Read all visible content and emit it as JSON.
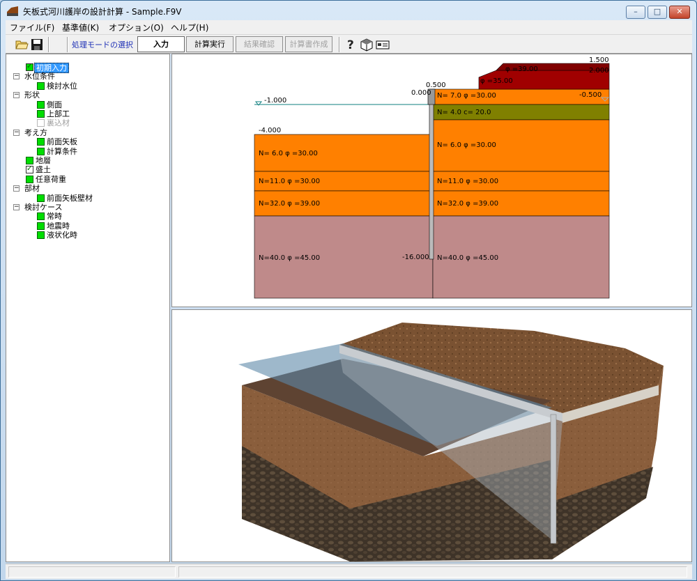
{
  "window": {
    "title": "矢板式河川護岸の設計計算 - Sample.F9V",
    "minimize": "–",
    "maximize": "□",
    "close": "✕"
  },
  "menu": [
    "ファイル(F)",
    "基準値(K)",
    "オプション(O)",
    "ヘルプ(H)"
  ],
  "toolbar": {
    "mode_label": "処理モードの選択",
    "modes": [
      {
        "label": "入力",
        "state": "active"
      },
      {
        "label": "計算実行",
        "state": "enabled"
      },
      {
        "label": "結果確認",
        "state": "disabled"
      },
      {
        "label": "計算書作成",
        "state": "disabled"
      }
    ],
    "icons": [
      "open-folder-icon",
      "save-icon",
      "help-icon",
      "3d-view-icon",
      "card-icon"
    ]
  },
  "tree": [
    {
      "label": "初期入力",
      "mark": "check-green",
      "level": 0,
      "selected": true
    },
    {
      "label": "水位条件",
      "mark": "none",
      "level": 1,
      "expander": "−"
    },
    {
      "label": "検討水位",
      "mark": "green",
      "level": 2
    },
    {
      "label": "形状",
      "mark": "none",
      "level": 1,
      "expander": "−"
    },
    {
      "label": "側面",
      "mark": "green",
      "level": 2
    },
    {
      "label": "上部工",
      "mark": "green",
      "level": 2
    },
    {
      "label": "裏込材",
      "mark": "gray",
      "level": 2,
      "disabled": true
    },
    {
      "label": "考え方",
      "mark": "none",
      "level": 1,
      "expander": "−"
    },
    {
      "label": "前面矢板",
      "mark": "green",
      "level": 2
    },
    {
      "label": "計算条件",
      "mark": "green",
      "level": 2
    },
    {
      "label": "地層",
      "mark": "green",
      "level": 0
    },
    {
      "label": "盛土",
      "mark": "check",
      "level": 0
    },
    {
      "label": "任意荷重",
      "mark": "green",
      "level": 0
    },
    {
      "label": "部材",
      "mark": "none",
      "level": 1,
      "expander": "−"
    },
    {
      "label": "前面矢板壁材",
      "mark": "green",
      "level": 2
    },
    {
      "label": "検討ケース",
      "mark": "none",
      "level": 1,
      "expander": "−"
    },
    {
      "label": "常時",
      "mark": "green",
      "level": 2
    },
    {
      "label": "地震時",
      "mark": "green",
      "level": 2
    },
    {
      "label": "液状化時",
      "mark": "green",
      "level": 2
    }
  ],
  "section": {
    "colors": {
      "orange": "#ff8000",
      "olive": "#808000",
      "maroon": "#a00000",
      "pink": "#bf8a8a",
      "water": "#0f7f7f"
    },
    "elevations": {
      "top_right": "1.500",
      "embank_top": "2.000",
      "wall_top": "0.500",
      "ground_zero": "0.000",
      "water_left": "-1.000",
      "water_right": "-0.500",
      "left_ground": "-4.000",
      "wall_bottom": "-16.000"
    },
    "left_layers": [
      "N=  6.0  φ =30.00",
      "N=11.0  φ =30.00",
      "N=32.0  φ =39.00",
      "N=40.0  φ =45.00"
    ],
    "right_layers": [
      "N=  7.0  φ =30.00",
      "N=  4.0  c=   20.0",
      "N=  6.0  φ =30.00",
      "N=11.0  φ =30.00",
      "N=32.0  φ =39.00",
      "N=40.0  φ =45.00"
    ],
    "embank_layers": [
      "φ =39.00",
      "φ =35.00"
    ]
  },
  "view3d": {
    "colors": {
      "soil": "#8a5e3c",
      "rock": "#3e3328",
      "water": "#5e89a8",
      "wall": "#c8ccd0"
    }
  }
}
